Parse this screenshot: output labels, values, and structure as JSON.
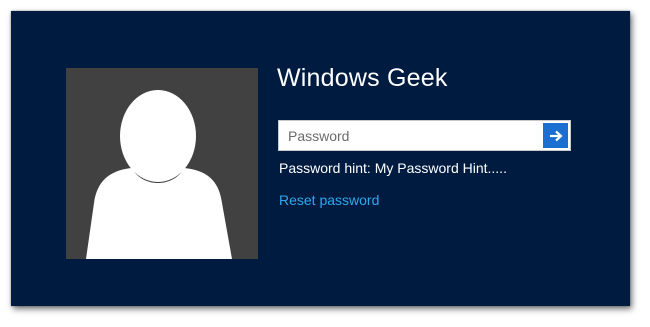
{
  "user": {
    "name": "Windows Geek",
    "avatar_icon": "user-silhouette-icon"
  },
  "password": {
    "value": "",
    "placeholder": "Password",
    "submit_icon": "arrow-right-icon"
  },
  "hint": {
    "text": "Password hint: My Password Hint....."
  },
  "links": {
    "reset_password": "Reset password"
  },
  "colors": {
    "background": "#001b40",
    "avatar_tile": "#414141",
    "accent_button": "#1b6fd0",
    "link": "#2ea9ec",
    "text": "#ffffff"
  }
}
